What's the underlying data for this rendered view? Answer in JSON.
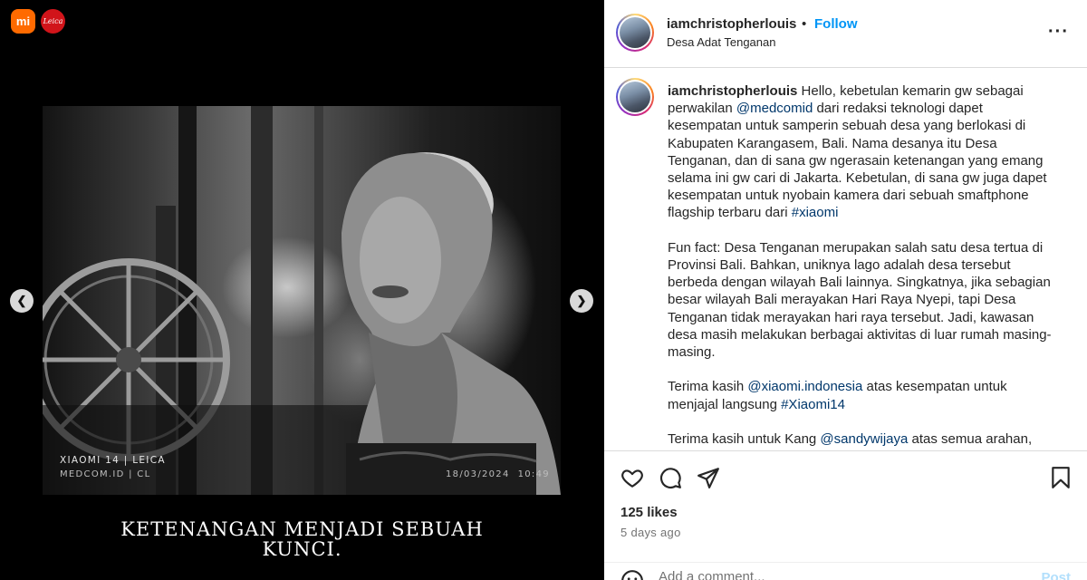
{
  "media": {
    "badges": {
      "xiaomi": "mi",
      "leica": "Leica"
    },
    "watermark": {
      "line1": "XIAOMI 14 | LEICA",
      "line2": "MEDCOM.ID | CL",
      "datetime": "18/03/2024  10:49"
    },
    "caption_lines": [
      "KETENANGAN MENJADI SEBUAH",
      "KUNCI."
    ],
    "prev_icon": "chevron-left-icon",
    "next_icon": "chevron-right-icon"
  },
  "post": {
    "username": "iamchristopherlouis",
    "separator": "•",
    "follow_label": "Follow",
    "location": "Desa Adat Tenganan",
    "more_icon": "more-horizontal-icon"
  },
  "caption": {
    "username": "iamchristopherlouis",
    "para1_a": "Hello, kebetulan kemarin gw sebagai perwakilan ",
    "mention1": "@medcomid",
    "para1_b": " dari redaksi teknologi dapet kesempatan untuk samperin sebuah desa yang berlokasi di Kabupaten Karangasem, Bali. Nama desanya itu Desa Tenganan, dan di sana gw ngerasain ketenangan yang emang selama ini gw cari di Jakarta. Kebetulan, di sana gw juga dapet kesempatan untuk nyobain kamera dari sebuah smaftphone flagship terbaru dari ",
    "hashtag1": "#xiaomi",
    "para2": "Fun fact: Desa Tenganan merupakan salah satu desa tertua di Provinsi Bali. Bahkan, uniknya lago adalah desa tersebut berbeda dengan wilayah Bali lainnya. Singkatnya, jika sebagian besar wilayah Bali merayakan Hari Raya Nyepi, tapi Desa Tenganan tidak merayakan hari raya tersebut. Jadi, kawasan desa masih melakukan berbagai aktivitas di luar rumah masing-masing.",
    "para3_a": "Terima kasih ",
    "mention2": "@xiaomi.indonesia",
    "para3_b": " atas kesempatan untuk menjajal langsung ",
    "hashtag2": "#Xiaomi14",
    "para4_a": "Terima kasih untuk Kang ",
    "mention3": "@sandywijaya",
    "para4_b": " atas semua arahan,"
  },
  "actions": {
    "like_icon": "heart-icon",
    "comment_icon": "comment-icon",
    "share_icon": "share-icon",
    "save_icon": "bookmark-icon",
    "likes": "125 likes",
    "time_ago": "5 days ago"
  },
  "comment_box": {
    "emoji_icon": "emoji-icon",
    "placeholder": "Add a comment...",
    "post_label": "Post"
  },
  "colors": {
    "link": "#00376b",
    "follow": "#0095f6",
    "post_disabled": "#b2dffc"
  }
}
